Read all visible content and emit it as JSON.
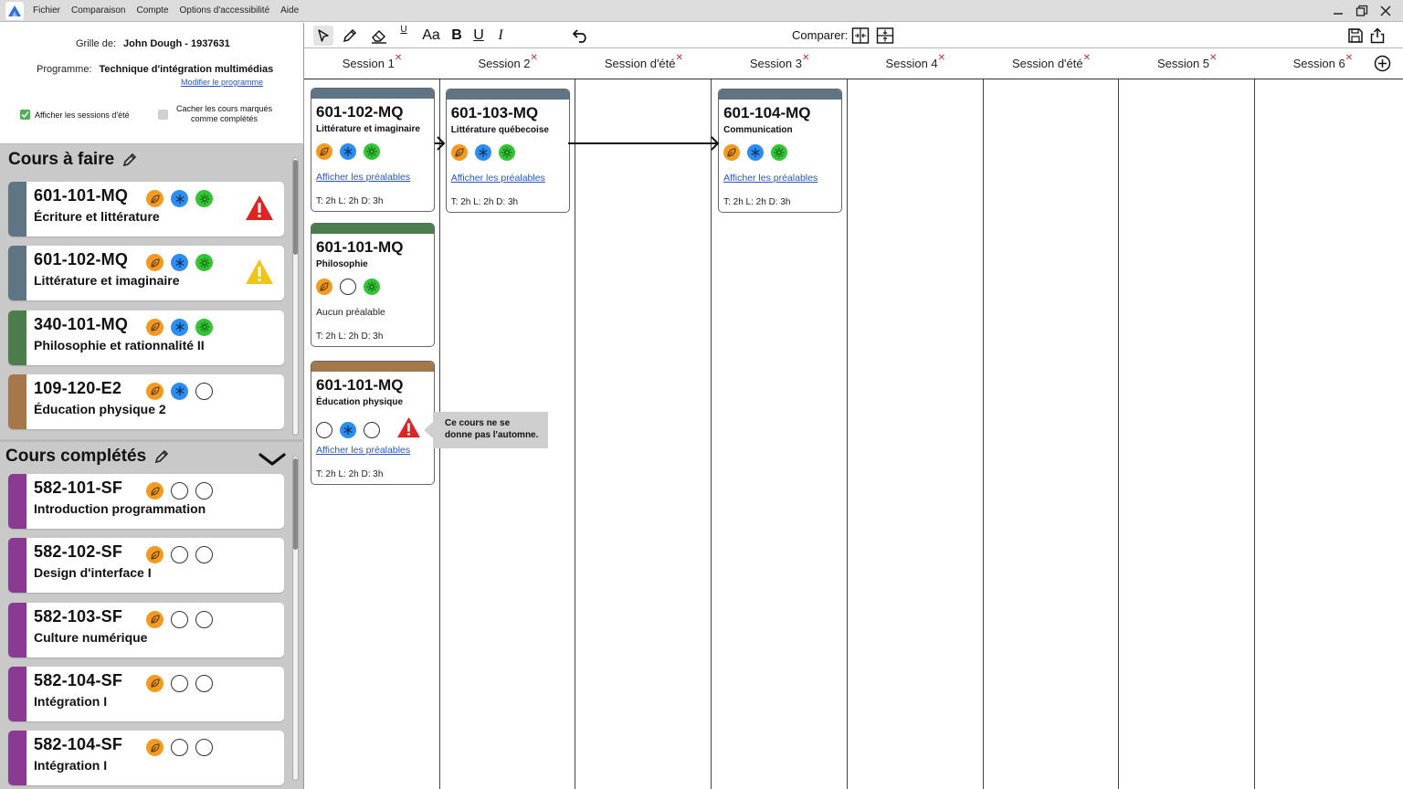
{
  "menu": {
    "items": [
      "Fichier",
      "Comparaison",
      "Compte",
      "Options d'accessibilité",
      "Aide"
    ]
  },
  "info": {
    "grid_label": "Grille de:",
    "grid_value": "John Dough - 1937631",
    "program_label": "Programme:",
    "program_value": "Technique d'intégration multimédias",
    "modify_link": "Modifier le programme",
    "show_summer_label": "Afficher les sessions d'été",
    "hide_completed_label_1": "Cacher les cours marqués",
    "hide_completed_label_2": "comme complétés"
  },
  "todo": {
    "title": "Cours à faire",
    "items": [
      {
        "code": "601-101-MQ",
        "name": "Écriture et littérature",
        "color": "#5f7584",
        "seasons": [
          "autumn",
          "winter",
          "summer"
        ],
        "warning": "red"
      },
      {
        "code": "601-102-MQ",
        "name": "Littérature et imaginaire",
        "color": "#5f7584",
        "seasons": [
          "autumn",
          "winter",
          "summer"
        ],
        "warning": "yellow"
      },
      {
        "code": "340-101-MQ",
        "name": "Philosophie et rationnalité II",
        "color": "#4c7d4c",
        "seasons": [
          "autumn",
          "winter",
          "summer"
        ],
        "warning": ""
      },
      {
        "code": "109-120-E2",
        "name": "Éducation physique 2",
        "color": "#a4784a",
        "seasons": [
          "autumn",
          "winter",
          "empty"
        ],
        "warning": ""
      }
    ]
  },
  "completed": {
    "title": "Cours complétés",
    "items": [
      {
        "code": "582-101-SF",
        "name": "Introduction programmation",
        "color": "#8a3a92",
        "seasons": [
          "autumn",
          "empty",
          "empty"
        ]
      },
      {
        "code": "582-102-SF",
        "name": "Design d'interface I",
        "color": "#8a3a92",
        "seasons": [
          "autumn",
          "empty",
          "empty"
        ]
      },
      {
        "code": "582-103-SF",
        "name": "Culture numérique",
        "color": "#8a3a92",
        "seasons": [
          "autumn",
          "empty",
          "empty"
        ]
      },
      {
        "code": "582-104-SF",
        "name": "Intégration I",
        "color": "#8a3a92",
        "seasons": [
          "autumn",
          "empty",
          "empty"
        ]
      },
      {
        "code": "582-104-SF",
        "name": "Intégration I",
        "color": "#8a3a92",
        "seasons": [
          "autumn",
          "empty",
          "empty"
        ]
      }
    ]
  },
  "toolbar": {
    "font_label": "Aa",
    "bold_label": "B",
    "underline_label": "U",
    "italic_label": "I",
    "compare_label": "Comparer:"
  },
  "sessions": [
    "Session 1",
    "Session 2",
    "Session d'été",
    "Session 3",
    "Session 4",
    "Session d'été",
    "Session 5",
    "Session 6"
  ],
  "cards": [
    {
      "col": 0,
      "code": "601-102-MQ",
      "name": "Littérature et imaginaire",
      "color": "#5f7584",
      "seasons": [
        "autumn",
        "winter",
        "summer"
      ],
      "link": "Afficher les préalables",
      "hours": "T: 2h L: 2h D: 3h",
      "warning": false
    },
    {
      "col": 1,
      "code": "601-103-MQ",
      "name": "Littérature québecoise",
      "color": "#5f7584",
      "seasons": [
        "autumn",
        "winter",
        "summer"
      ],
      "link": "Afficher les préalables",
      "hours": "T: 2h L: 2h D: 3h",
      "warning": false
    },
    {
      "col": 3,
      "code": "601-104-MQ",
      "name": "Communication",
      "color": "#5f7584",
      "seasons": [
        "autumn",
        "winter",
        "summer"
      ],
      "link": "Afficher les préalables",
      "hours": "T: 2h L: 2h D: 3h",
      "warning": false
    },
    {
      "col": 0,
      "code": "601-101-MQ",
      "name": "Philosophie",
      "color": "#4c7d4c",
      "seasons": [
        "autumn",
        "empty",
        "summer"
      ],
      "nolink": "Aucun préalable",
      "hours": "T: 2h L: 2h D: 3h",
      "warning": false
    },
    {
      "col": 0,
      "code": "601-101-MQ",
      "name": "Éducation physique",
      "color": "#a4784a",
      "seasons": [
        "empty",
        "winter",
        "empty"
      ],
      "link": "Afficher les préalables",
      "hours": "T: 2h L: 2h D: 3h",
      "warning": true
    }
  ],
  "tooltip": {
    "line1": "Ce cours ne se",
    "line2": "donne pas l'automne."
  },
  "colors": {
    "autumn": "#f29b20",
    "winter": "#2e8ef0",
    "summer": "#34c435",
    "danger": "#e02424",
    "warning": "#f0c419",
    "link": "#2a55c8",
    "remove": "#d42b2b"
  }
}
